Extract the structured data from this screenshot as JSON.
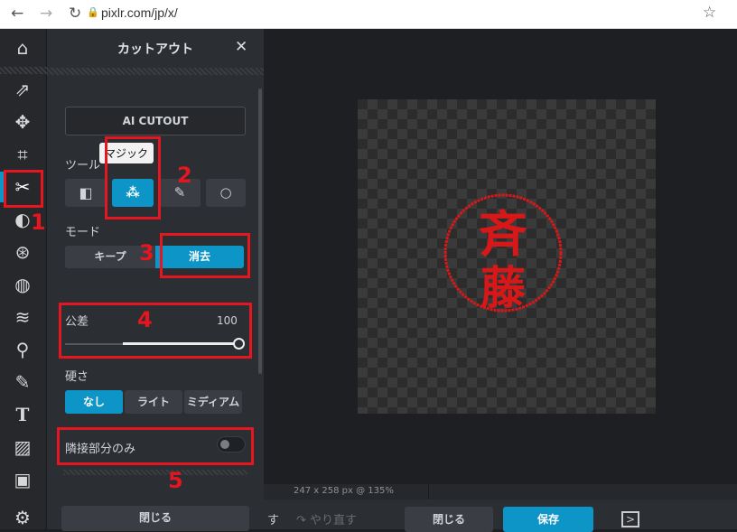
{
  "browser": {
    "url": "pixlr.com/jp/x/"
  },
  "panel": {
    "title": "カットアウト",
    "ai_cutout": "AI CUTOUT",
    "tooltip": "マジック",
    "tool_label": "ツール",
    "mode_label": "モード",
    "mode_keep": "キープ",
    "mode_erase": "消去",
    "tolerance_label": "公差",
    "tolerance_value": "100",
    "tolerance_percent": 100,
    "hardness_label": "硬さ",
    "hardness_options": [
      "なし",
      "ライト",
      "ミディアム"
    ],
    "adjacent_label": "隣接部分のみ",
    "adjacent_on": false,
    "close": "閉じる"
  },
  "annotations": [
    "1",
    "2",
    "3",
    "4",
    "5"
  ],
  "status": {
    "info": "247 x 258 px @ 135%"
  },
  "bottom": {
    "undo": "す",
    "redo": "やり直す",
    "close": "閉じる",
    "save": "保存"
  },
  "colors": {
    "accent": "#0d95c8",
    "annotation": "#e5161f",
    "stamp": "#d81818"
  }
}
